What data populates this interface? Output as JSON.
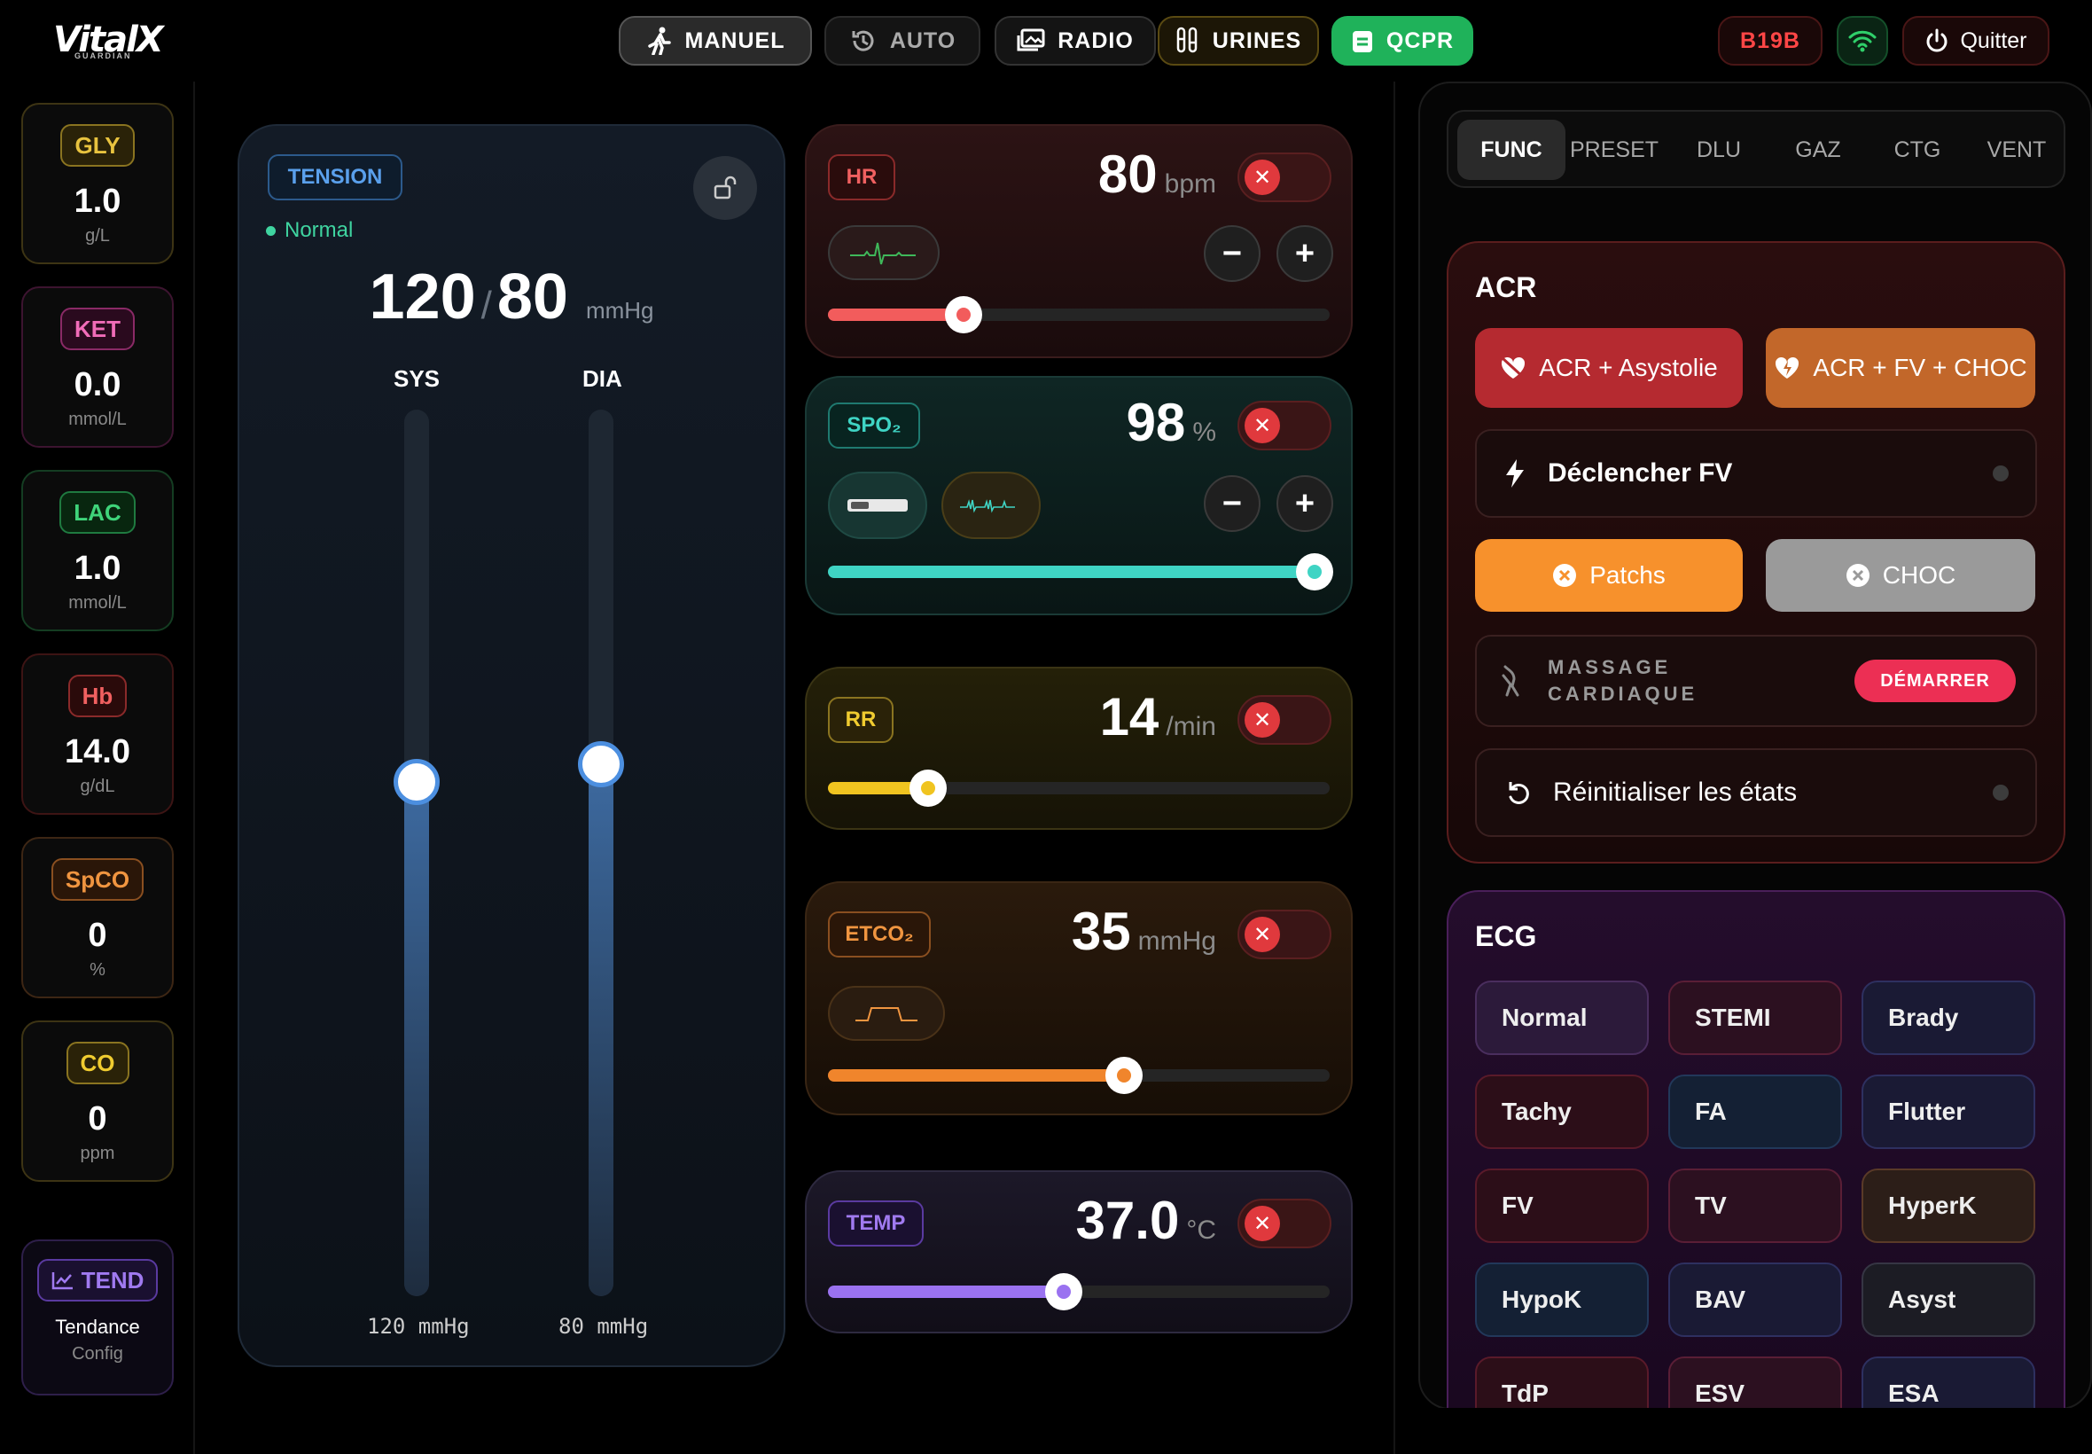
{
  "brand": {
    "name_a": "VitalX",
    "name_b": "X",
    "sub": "GUARDIAN"
  },
  "header": {
    "modes": [
      {
        "label": "MANUEL"
      },
      {
        "label": "AUTO"
      },
      {
        "label": "RADIO"
      },
      {
        "label": "URINES"
      },
      {
        "label": "QCPR"
      }
    ],
    "device_id": "B19B",
    "quit_label": "Quitter"
  },
  "labs": [
    {
      "tag": "GLY",
      "value": "1.0",
      "unit": "g/L",
      "color": "#d8b43a"
    },
    {
      "tag": "KET",
      "value": "0.0",
      "unit": "mmol/L",
      "color": "#e05aa8"
    },
    {
      "tag": "LAC",
      "value": "1.0",
      "unit": "mmol/L",
      "color": "#33c46a"
    },
    {
      "tag": "Hb",
      "value": "14.0",
      "unit": "g/dL",
      "color": "#e05353"
    },
    {
      "tag": "SpCO",
      "value": "0",
      "unit": "%",
      "color": "#e88a3a"
    },
    {
      "tag": "CO",
      "value": "0",
      "unit": "ppm",
      "color": "#e0c43a"
    }
  ],
  "trend": {
    "tag": "TEND",
    "line1": "Tendance",
    "line2": "Config"
  },
  "tension": {
    "tag": "TENSION",
    "status": "Normal",
    "sys": "120",
    "sep": "/",
    "dia": "80",
    "unit": "mmHg",
    "sys_label": "SYS",
    "dia_label": "DIA",
    "sys_readout": "120 mmHg",
    "dia_readout": "80 mmHg",
    "sys_level": 0.58,
    "dia_level": 0.6
  },
  "vitals": {
    "hr": {
      "tag": "HR",
      "value": "80",
      "unit": "bpm",
      "level": 0.27
    },
    "spo2": {
      "tag": "SPO₂",
      "value": "98",
      "unit": "%",
      "level": 0.97
    },
    "rr": {
      "tag": "RR",
      "value": "14",
      "unit": "/min",
      "level": 0.2
    },
    "etco2": {
      "tag": "ETCO₂",
      "value": "35",
      "unit": "mmHg",
      "level": 0.59
    },
    "temp": {
      "tag": "TEMP",
      "value": "37.0",
      "unit": "°C",
      "level": 0.47
    }
  },
  "right": {
    "tabs": [
      "FUNC",
      "PRESET",
      "DLU",
      "GAZ",
      "CTG",
      "VENT"
    ],
    "acr": {
      "title": "ACR",
      "btn_asystole": "ACR + Asystolie",
      "btn_fv": "ACR + FV + CHOC",
      "trigger_fv": "Déclencher FV",
      "patchs": "Patchs",
      "choc": "CHOC",
      "massage_1": "MASSAGE",
      "massage_2": "CARDIAQUE",
      "start": "DÉMARRER",
      "reset": "Réinitialiser les états"
    },
    "ecg": {
      "title": "ECG",
      "rhythms": [
        "Normal",
        "STEMI",
        "Brady",
        "Tachy",
        "FA",
        "Flutter",
        "FV",
        "TV",
        "HyperK",
        "HypoK",
        "BAV",
        "Asyst",
        "TdP",
        "ESV",
        "ESA"
      ]
    }
  }
}
